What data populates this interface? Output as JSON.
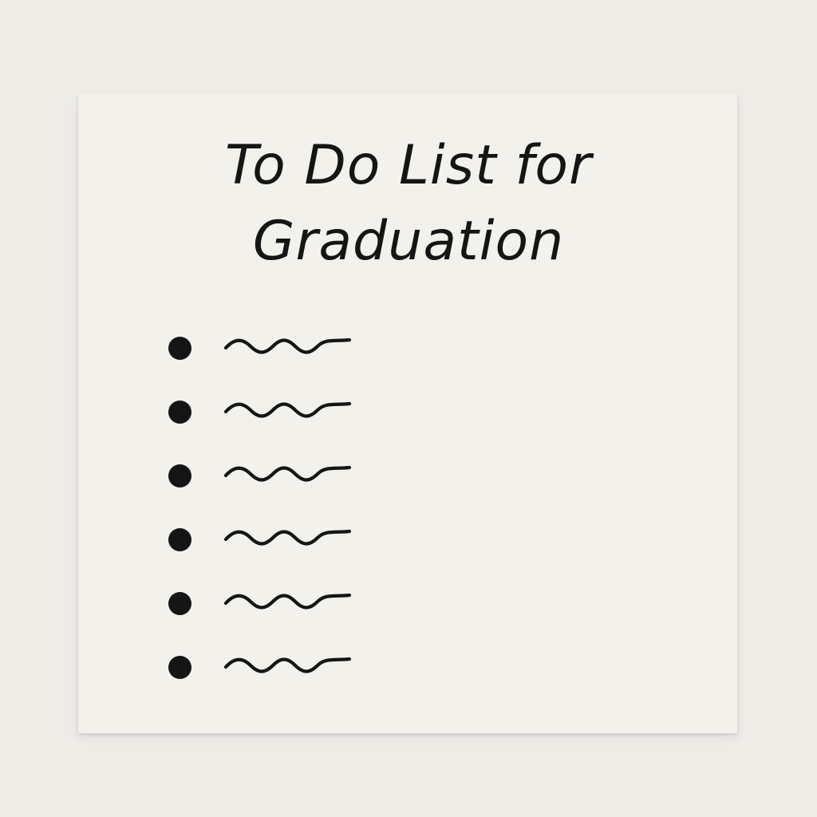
{
  "note": {
    "title_line_1": "To Do List for",
    "title_line_2": "Graduation",
    "items": [
      {
        "placeholder": "squiggle"
      },
      {
        "placeholder": "squiggle"
      },
      {
        "placeholder": "squiggle"
      },
      {
        "placeholder": "squiggle"
      },
      {
        "placeholder": "squiggle"
      },
      {
        "placeholder": "squiggle"
      }
    ]
  },
  "colors": {
    "background": "#eeece7",
    "card": "#f2f1ec",
    "ink": "#151515"
  }
}
